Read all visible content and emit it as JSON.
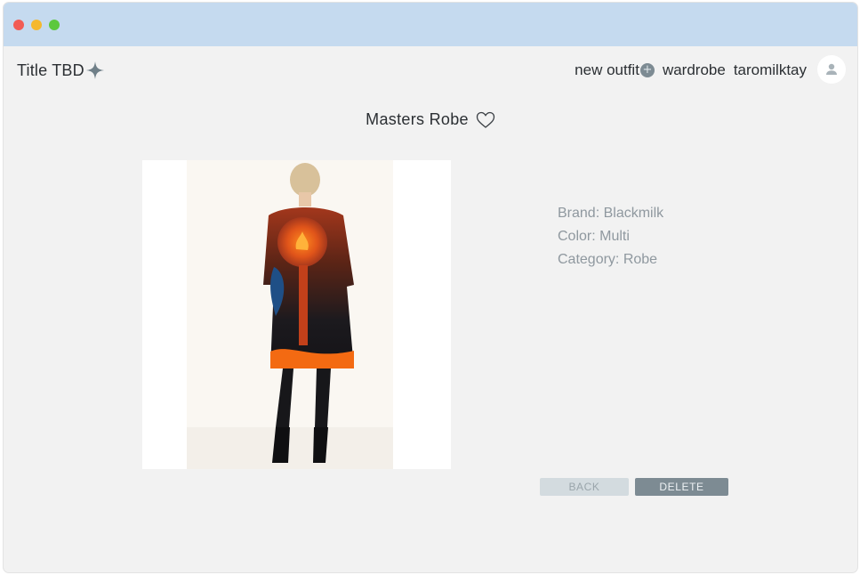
{
  "window": {
    "controls": [
      "close",
      "minimize",
      "maximize"
    ],
    "colors": {
      "titlebar": "#c5daef",
      "close": "#f25c54",
      "minimize": "#f5b82e",
      "maximize": "#5cc83c"
    }
  },
  "header": {
    "app_title": "Title TBD",
    "logo_icon": "sparkle-icon",
    "nav": {
      "new_outfit": "new outfit",
      "new_outfit_icon": "plus-circle-icon",
      "wardrobe": "wardrobe",
      "username": "taromilktay"
    },
    "avatar_icon": "user-icon"
  },
  "item": {
    "name": "Masters Robe",
    "favorite_icon": "heart-outline-icon",
    "image_alt": "Model wearing black and orange printed robe with sun motif, back view",
    "details": {
      "brand": "Brand: Blackmilk",
      "color": "Color: Multi",
      "category": "Category: Robe"
    }
  },
  "actions": {
    "back": "BACK",
    "delete": "DELETE"
  },
  "colors": {
    "background": "#f2f2f2",
    "accent": "#7d8b93",
    "muted_button": "#d3dbdf",
    "detail_text": "#8f989f"
  }
}
